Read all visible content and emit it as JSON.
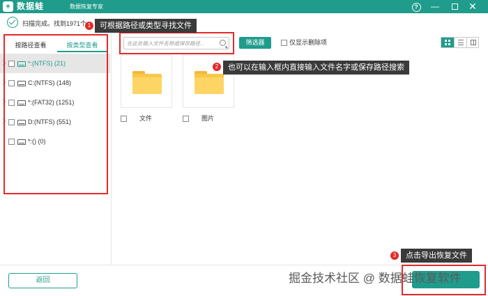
{
  "titlebar": {
    "logo": "+",
    "app_name": "数据蛙",
    "subtitle": "数据恢复专家",
    "help": "?",
    "minimize": "—",
    "close": "✕"
  },
  "status": {
    "text": "扫描完成。找到1971个"
  },
  "sidebar": {
    "tabs": [
      {
        "label": "按路径查看",
        "active": false
      },
      {
        "label": "按类型查看",
        "active": true
      }
    ],
    "drives": [
      {
        "label": "*:(NTFS) (21)",
        "selected": true
      },
      {
        "label": "C:(NTFS) (148)",
        "selected": false
      },
      {
        "label": "*:(FAT32) (1251)",
        "selected": false
      },
      {
        "label": "D:(NTFS) (551)",
        "selected": false
      },
      {
        "label": "*:() (0)",
        "selected": false
      }
    ]
  },
  "toolbar": {
    "search_placeholder": "在此处输入文件名称或保存路径...",
    "filter_label": "筛选器",
    "show_deleted_label": "仅显示删除项"
  },
  "files": [
    {
      "name": "文件",
      "icon": "folder-icon"
    },
    {
      "name": "图片",
      "icon": "folder-icon"
    }
  ],
  "callouts": [
    {
      "num": "1",
      "text": "可根据路径或类型寻找文件"
    },
    {
      "num": "2",
      "text": "也可以在输入框内直接输入文件名字或保存路径搜索"
    },
    {
      "num": "3",
      "text": "点击导出恢复文件"
    }
  ],
  "footer": {
    "back_label": "返回",
    "watermark": "掘金技术社区 @ 数据蛙恢复软件"
  },
  "colors": {
    "accent": "#1f9c8c",
    "highlight_red": "#e32929",
    "callout_bg": "#3a3a3a",
    "folder": "#f9c846"
  }
}
